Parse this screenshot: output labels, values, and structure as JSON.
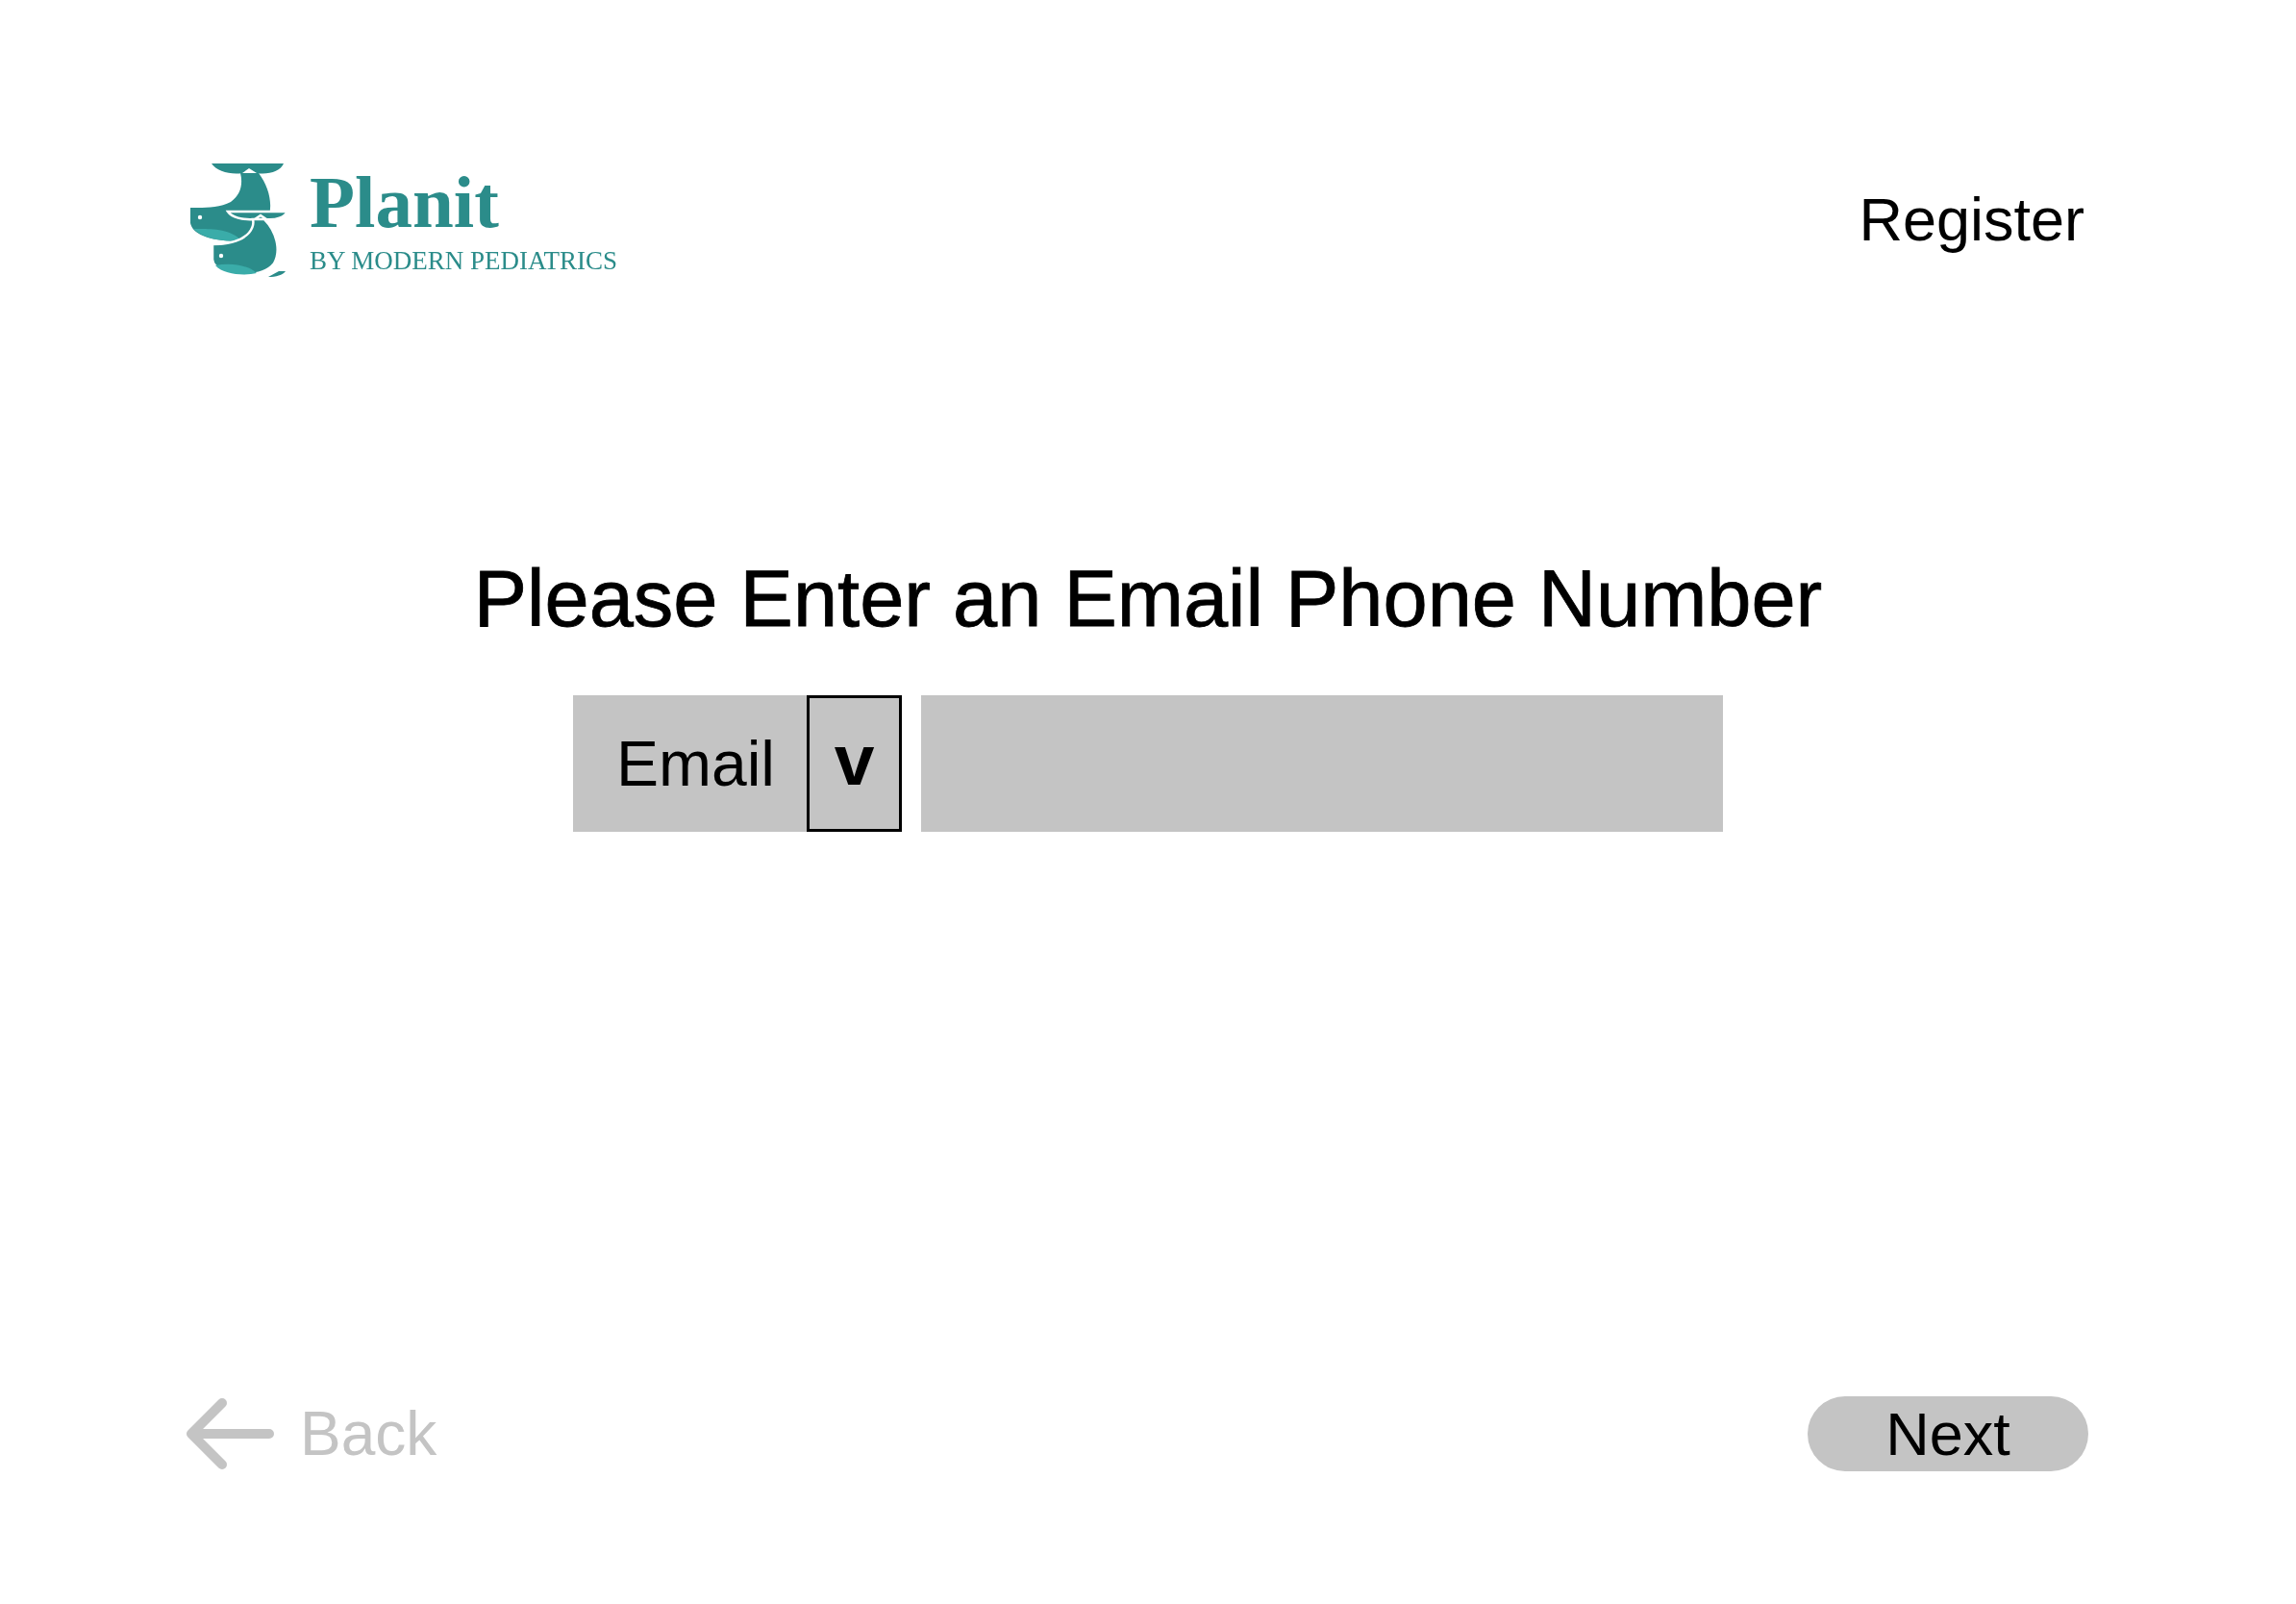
{
  "header": {
    "logo": {
      "name": "Planit",
      "tagline": "BY MODERN PEDIATRICS"
    },
    "register_link": "Register"
  },
  "title": "Please Enter an Email Phone Number",
  "contact_form": {
    "type_dropdown": {
      "value": "Email",
      "toggle": "v"
    }
  },
  "footer": {
    "back_button": {
      "label": "Back",
      "disabled": true
    },
    "next_button": {
      "label": "Next"
    }
  }
}
